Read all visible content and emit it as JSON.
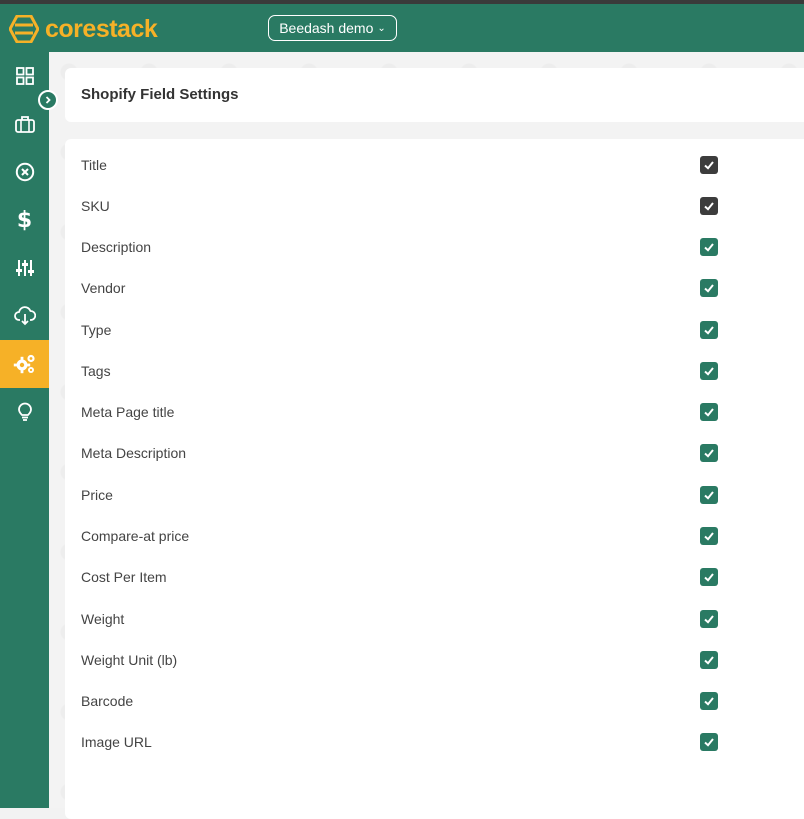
{
  "app": {
    "logo_part1": "core",
    "logo_part2": "stack",
    "org_selector": "Beedash demo",
    "colors": {
      "brand": "#2a7a63",
      "accent": "#f6b127",
      "checkbox_checked": "#2a7a63",
      "checkbox_disabled": "#3c3c3c"
    }
  },
  "sidebar": {
    "items": [
      {
        "icon": "dashboard-grid-icon",
        "active": false
      },
      {
        "icon": "briefcase-icon",
        "active": false
      },
      {
        "icon": "circle-x-icon",
        "active": false
      },
      {
        "icon": "dollar-icon",
        "active": false
      },
      {
        "icon": "sliders-icon",
        "active": false
      },
      {
        "icon": "cloud-download-icon",
        "active": false
      },
      {
        "icon": "gears-icon",
        "active": true
      },
      {
        "icon": "lightbulb-icon",
        "active": false
      }
    ],
    "expand_icon": "chevron-right-icon"
  },
  "page": {
    "title": "Shopify Field Settings"
  },
  "fields": [
    {
      "label": "Title",
      "checked": true,
      "locked": true
    },
    {
      "label": "SKU",
      "checked": true,
      "locked": true
    },
    {
      "label": "Description",
      "checked": true,
      "locked": false
    },
    {
      "label": "Vendor",
      "checked": true,
      "locked": false
    },
    {
      "label": "Type",
      "checked": true,
      "locked": false
    },
    {
      "label": "Tags",
      "checked": true,
      "locked": false
    },
    {
      "label": "Meta Page title",
      "checked": true,
      "locked": false
    },
    {
      "label": "Meta Description",
      "checked": true,
      "locked": false
    },
    {
      "label": "Price",
      "checked": true,
      "locked": false
    },
    {
      "label": "Compare-at price",
      "checked": true,
      "locked": false
    },
    {
      "label": "Cost Per Item",
      "checked": true,
      "locked": false
    },
    {
      "label": "Weight",
      "checked": true,
      "locked": false
    },
    {
      "label": "Weight Unit (lb)",
      "checked": true,
      "locked": false
    },
    {
      "label": "Barcode",
      "checked": true,
      "locked": false
    },
    {
      "label": "Image URL",
      "checked": true,
      "locked": false
    }
  ]
}
